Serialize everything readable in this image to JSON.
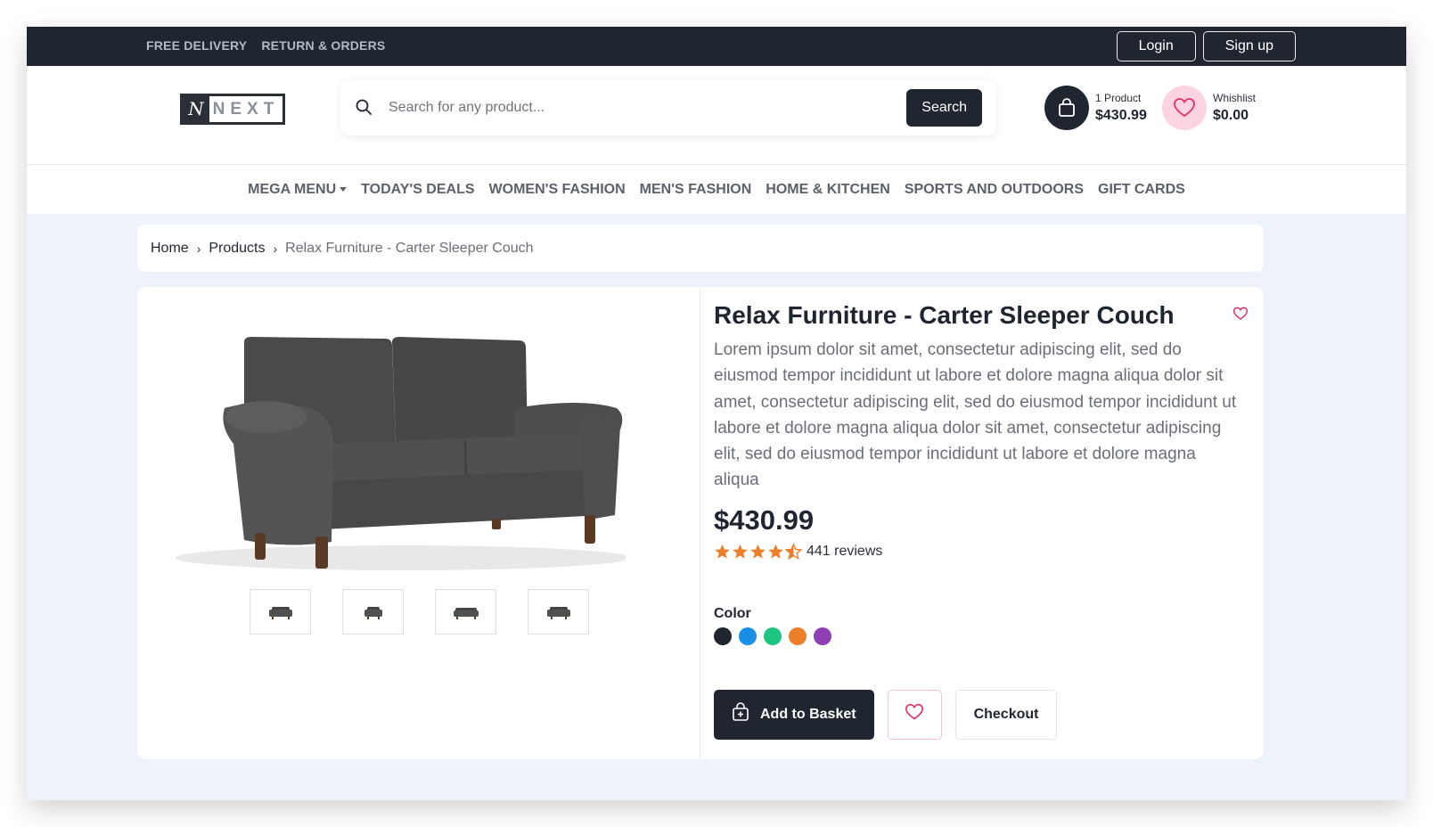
{
  "topbar": {
    "links": [
      "FREE DELIVERY",
      "RETURN & ORDERS"
    ],
    "login_label": "Login",
    "signup_label": "Sign up"
  },
  "header": {
    "logo_mark": "N",
    "logo_text": "NEXT",
    "search": {
      "placeholder": "Search for any product...",
      "button_label": "Search"
    },
    "cart": {
      "count_label": "1 Product",
      "amount": "$430.99"
    },
    "wishlist": {
      "label": "Whishlist",
      "amount": "$0.00"
    }
  },
  "nav": {
    "items": [
      "MEGA MENU",
      "TODAY'S DEALS",
      "WOMEN'S FASHION",
      "MEN'S FASHION",
      "HOME & KITCHEN",
      "SPORTS AND OUTDOORS",
      "GIFT CARDS"
    ]
  },
  "breadcrumb": {
    "home": "Home",
    "products": "Products",
    "current": "Relax Furniture - Carter Sleeper Couch",
    "separator": "›"
  },
  "product": {
    "title": "Relax Furniture - Carter Sleeper Couch",
    "description": "Lorem ipsum dolor sit amet, consectetur adipiscing elit, sed do eiusmod tempor incididunt ut labore et dolore magna aliqua dolor sit amet, consectetur adipiscing elit, sed do eiusmod tempor incididunt ut labore et dolore magna aliqua dolor sit amet, consectetur adipiscing elit, sed do eiusmod tempor incididunt ut labore et dolore magna aliqua",
    "price": "$430.99",
    "rating": 4.5,
    "reviews": "441 reviews",
    "color_label": "Color",
    "colors": [
      "#1f2630",
      "#1a8fe8",
      "#1ec580",
      "#ec7f2a",
      "#8e3fb3"
    ],
    "add_label": "Add to Basket",
    "checkout_label": "Checkout"
  },
  "colors": {
    "dark": "#1f2630",
    "accent_pink": "#e0306a",
    "star": "#ec7f2a",
    "background": "#eef2fb"
  }
}
